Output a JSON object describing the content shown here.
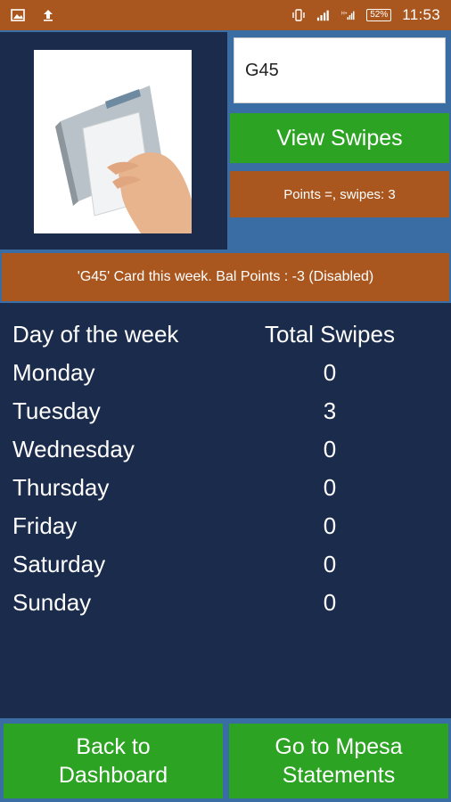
{
  "status_bar": {
    "time": "11:53",
    "battery": "52%",
    "icons": [
      "image-icon",
      "upload-icon",
      "vibrate-icon",
      "signal-icon",
      "network-h-icon",
      "battery-icon"
    ]
  },
  "card_input": {
    "value": "G45"
  },
  "buttons": {
    "view_swipes": "View Swipes",
    "back_to_dashboard": "Back to\nDashboard",
    "go_to_mpesa": "Go to Mpesa\nStatements"
  },
  "points_text": "Points =, swipes: 3",
  "info_banner": "'G45' Card this week. Bal Points : -3 (Disabled)",
  "table": {
    "headers": [
      "Day of the week",
      "Total Swipes"
    ],
    "rows": [
      {
        "day": "Monday",
        "swipes": "0"
      },
      {
        "day": "Tuesday",
        "swipes": "3"
      },
      {
        "day": "Wednesday",
        "swipes": "0"
      },
      {
        "day": "Thursday",
        "swipes": "0"
      },
      {
        "day": "Friday",
        "swipes": "0"
      },
      {
        "day": "Saturday",
        "swipes": "0"
      },
      {
        "day": "Sunday",
        "swipes": "0"
      }
    ]
  },
  "colors": {
    "accent_orange": "#a9571f",
    "button_green": "#2ca323",
    "panel_navy": "#1a2b4c",
    "background_blue": "#3a6da3"
  }
}
